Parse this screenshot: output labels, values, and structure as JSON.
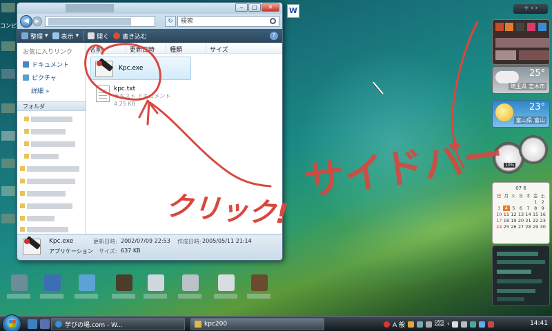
{
  "desktop": {
    "left_label": "コンピ",
    "word_icon_letter": "W"
  },
  "explorer": {
    "search_placeholder": "検索",
    "toolbar": {
      "organize": "整理",
      "views": "表示",
      "open": "開く",
      "burn": "書き込む"
    },
    "nav": {
      "favorites_header": "お気に入りリンク",
      "favorites": [
        "ドキュメント",
        "ピクチャ"
      ],
      "more": "詳細",
      "folders_header": "フォルダ"
    },
    "columns": [
      "名前",
      "更新日時",
      "種類",
      "サイズ"
    ],
    "files": [
      {
        "name": "Kpc.exe",
        "icon": "kpc-app-icon",
        "selected": true
      },
      {
        "name": "kpc.txt",
        "type": "テキスト ドキュメント",
        "size": "4.25 KB",
        "icon": "text-document-icon"
      }
    ],
    "details": {
      "name": "Kpc.exe",
      "type": "アプリケーション",
      "modified_label": "更新日時:",
      "modified": "2002/07/09 22:53",
      "created_label": "作成日時:",
      "created": "2005/05/11 21:14",
      "size_label": "サイズ:",
      "size": "637 KB"
    }
  },
  "annotations": {
    "click_text": "クリック!",
    "sidebar_text": "サイドバー",
    "color": "#d9473f"
  },
  "sidebar": {
    "top_controls": "+ ‹ ›",
    "weather": [
      {
        "temp": "25°",
        "place": "埼玉県 志木市"
      },
      {
        "temp": "23°",
        "place": "富山県 富山"
      }
    ],
    "meter_value": "10%",
    "calendar": {
      "month": "07 6",
      "weekdays": [
        "日",
        "月",
        "火",
        "水",
        "木",
        "金",
        "土"
      ],
      "days": [
        "",
        "",
        "",
        "",
        "",
        "1",
        "2",
        "3",
        "4",
        "5",
        "6",
        "7",
        "8",
        "9",
        "10",
        "11",
        "12",
        "13",
        "14",
        "15",
        "16",
        "17",
        "18",
        "19",
        "20",
        "21",
        "22",
        "23",
        "24",
        "25",
        "26",
        "27",
        "28",
        "29",
        "30"
      ],
      "today": "4"
    }
  },
  "taskbar": {
    "tasks": [
      {
        "label": "学びの場.com - W...",
        "icon": "ie-icon"
      },
      {
        "label": "kpc200",
        "icon": "folder-icon"
      }
    ],
    "ime": "A 般",
    "caps": "CAPS\nKANA",
    "clock": "14:41"
  }
}
